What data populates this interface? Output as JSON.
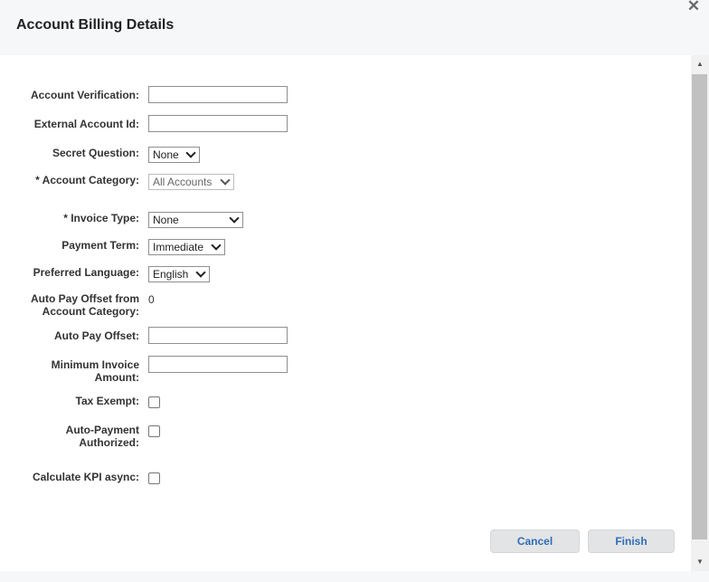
{
  "dialog": {
    "title": "Account Billing Details",
    "close_icon": "close-icon"
  },
  "form": {
    "account_verification": {
      "label": "Account Verification:",
      "value": ""
    },
    "external_account_id": {
      "label": "External Account Id:",
      "value": ""
    },
    "secret_question": {
      "label": "Secret Question:",
      "selected": "None"
    },
    "account_category": {
      "label": "* Account Category:",
      "selected": "All Accounts",
      "disabled": true
    },
    "invoice_type": {
      "label": "* Invoice Type:",
      "selected": "None"
    },
    "payment_term": {
      "label": "Payment Term:",
      "selected": "Immediate"
    },
    "preferred_language": {
      "label": "Preferred Language:",
      "selected": "English"
    },
    "auto_pay_offset_from_category": {
      "label_line1": "Auto Pay Offset from",
      "label_line2": "Account Category:",
      "value": "0"
    },
    "auto_pay_offset": {
      "label": "Auto Pay Offset:",
      "value": ""
    },
    "minimum_invoice_amount": {
      "label_line1": "Minimum Invoice",
      "label_line2": "Amount:",
      "value": ""
    },
    "tax_exempt": {
      "label": "Tax Exempt:",
      "checked": false
    },
    "auto_payment_authorized": {
      "label_line1": "Auto-Payment",
      "label_line2": "Authorized:",
      "checked": false
    },
    "calculate_kpi_async": {
      "label": "Calculate KPI async:",
      "checked": false
    }
  },
  "buttons": {
    "cancel": "Cancel",
    "finish": "Finish"
  },
  "scrollbar": {
    "up_icon": "▲",
    "down_icon": "▼"
  }
}
